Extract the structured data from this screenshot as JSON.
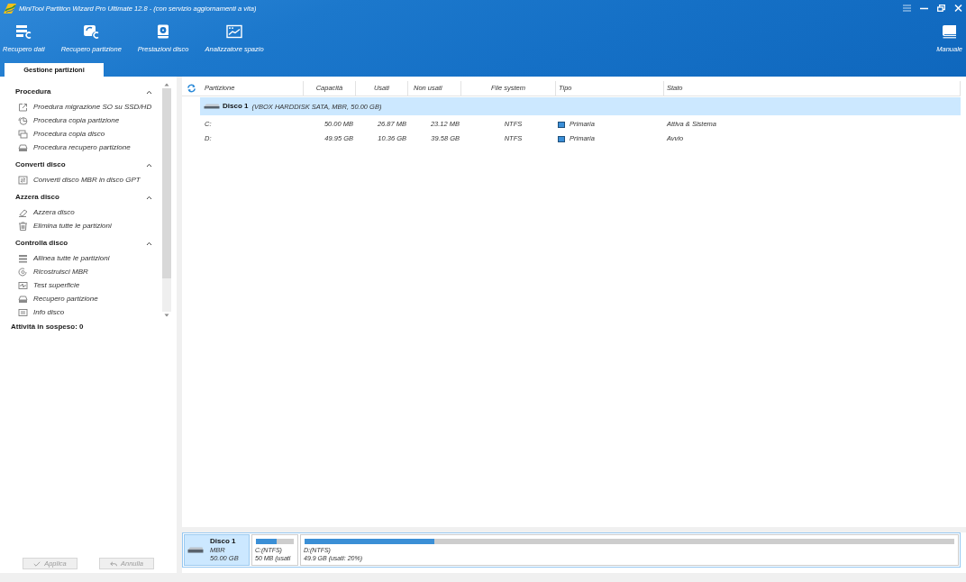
{
  "window": {
    "title": "MiniTool Partition Wizard Pro Ultimate 12.8 - (con servizio aggiornamenti a vita)"
  },
  "toolbar": {
    "items": [
      {
        "label": "Recupero dati"
      },
      {
        "label": "Recupero partizione"
      },
      {
        "label": "Prestazioni disco"
      },
      {
        "label": "Analizzatore spazio"
      }
    ],
    "manual": {
      "label": "Manuale"
    }
  },
  "tabs": [
    {
      "label": "Gestione partizioni",
      "selected": true
    }
  ],
  "sidebar": {
    "sections": [
      {
        "title": "Procedura",
        "expanded": true,
        "items": [
          "Proedura migrazione SO su SSD/HD",
          "Procedura copia partizione",
          "Procedura copia disco",
          "Procedura recupero partizione"
        ]
      },
      {
        "title": "Converti disco",
        "expanded": true,
        "items": [
          "Converti disco MBR in disco GPT"
        ]
      },
      {
        "title": "Azzera disco",
        "expanded": true,
        "items": [
          "Azzera disco",
          "Elimina tutte le partizioni"
        ]
      },
      {
        "title": "Controlla disco",
        "expanded": true,
        "items": [
          "Allinea tutte le partizioni",
          "Ricostruisci MBR",
          "Test superficie",
          "Recupero partizione",
          "Info disco"
        ]
      }
    ],
    "pending": "Attività in sospeso: 0",
    "buttons": [
      {
        "label": "Applica",
        "disabled": true
      },
      {
        "label": "Annulla",
        "disabled": true
      }
    ]
  },
  "table": {
    "columns": [
      "Partizione",
      "Capacità",
      "Usati",
      "Non usati",
      "File system",
      "Tipo",
      "Stato"
    ],
    "disks": [
      {
        "name": "Disco 1",
        "details": "(VBOX HARDDISK SATA, MBR, 50.00 GB)",
        "selected": true,
        "partitions": [
          {
            "cells": [
              "C:",
              "50.00 MB",
              "26.87 MB",
              "23.12 MB",
              "NTFS",
              "Primaria",
              "Attiva & Sistema"
            ],
            "selected": false
          },
          {
            "cells": [
              "D:",
              "49.95 GB",
              "10.36 GB",
              "39.58 GB",
              "NTFS",
              "Primaria",
              "Avvio"
            ],
            "selected": false
          }
        ]
      }
    ]
  },
  "disk_map": {
    "disks": [
      {
        "name": "Disco 1",
        "style": "MBR",
        "size": "50.00 GB",
        "selected": true,
        "partitions": [
          {
            "label": "C:(NTFS)",
            "usage": "50 MB (usati",
            "level": 0.54,
            "selected": false
          },
          {
            "label": "D:(NTFS)",
            "usage": "49.9 GB (usati: 20%)",
            "level": 0.2,
            "selected": false
          }
        ]
      }
    ]
  }
}
